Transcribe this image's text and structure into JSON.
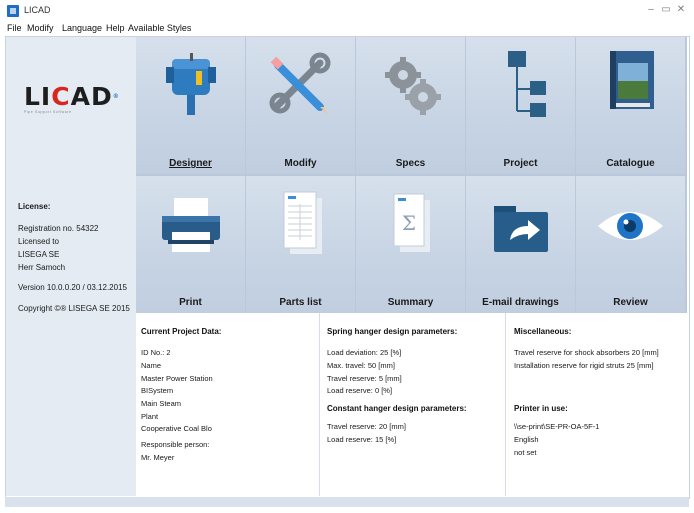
{
  "window": {
    "title": "LICAD"
  },
  "menu": [
    "File",
    "Modify",
    "Language",
    "Help",
    "Available Styles"
  ],
  "logo": {
    "tagline": "Pipe Support Software"
  },
  "license": {
    "heading": "License:",
    "registration": "Registration no.   54322",
    "licensed_to": "Licensed to",
    "company": "LISEGA SE",
    "user": "Herr Samoch",
    "version": "Version   10.0.0.20 / 03.12.2015",
    "copyright": "Copyright ©® LISEGA SE 2015"
  },
  "tiles": [
    {
      "label": "Designer",
      "icon": "designer-icon"
    },
    {
      "label": "Modify",
      "icon": "wrench-pencil-icon"
    },
    {
      "label": "Specs",
      "icon": "gears-icon"
    },
    {
      "label": "Project",
      "icon": "folder-tree-icon"
    },
    {
      "label": "Catalogue",
      "icon": "catalogue-book-icon"
    },
    {
      "label": "Print",
      "icon": "printer-icon"
    },
    {
      "label": "Parts list",
      "icon": "parts-list-icon"
    },
    {
      "label": "Summary",
      "icon": "summary-sigma-icon"
    },
    {
      "label": "E-mail drawings",
      "icon": "email-folder-icon"
    },
    {
      "label": "Review",
      "icon": "eye-icon"
    }
  ],
  "project": {
    "heading": "Current Project Data:",
    "id": "ID No.:       2",
    "lines": [
      "Name",
      "Master Power Station",
      "BISystem",
      "Main Steam",
      "Plant",
      "Cooperative Coal Blo"
    ],
    "responsible_label": "Responsible person:",
    "responsible": "Mr. Meyer"
  },
  "spring": {
    "heading": "Spring hanger design parameters:",
    "lines": [
      "Load deviation: 25 [%]",
      "Max. travel: 50 [mm]",
      "Travel reserve: 5 [mm]",
      "Load reserve: 0 [%]"
    ]
  },
  "constant": {
    "heading": "Constant hanger design parameters:",
    "lines": [
      "Travel reserve: 20 [mm]",
      "Load reserve: 15 [%]"
    ]
  },
  "misc": {
    "heading": "Miscellaneous:",
    "lines": [
      "Travel reserve for shock absorbers 20 [mm]",
      "Installation reserve for rigid struts 25 [mm]"
    ]
  },
  "printer": {
    "heading": "Printer in use:",
    "lines": [
      "\\\\se-print\\SE-PR-OA-5F-1",
      "English",
      "not set"
    ]
  },
  "colors": {
    "accent": "#1d6ec4",
    "tile": "#cdd9e7",
    "sidebar": "#e4ebf3",
    "logo_red": "#d9261c"
  }
}
